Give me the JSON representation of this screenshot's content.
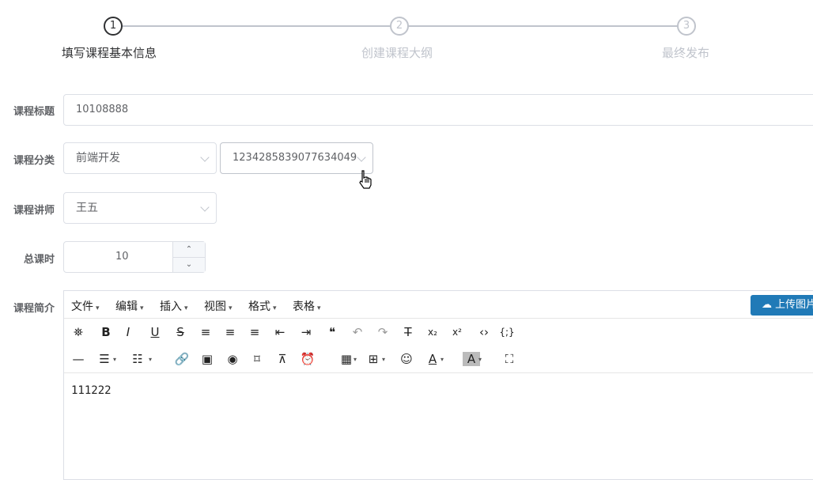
{
  "steps": [
    {
      "number": "1",
      "label": "填写课程基本信息"
    },
    {
      "number": "2",
      "label": "创建课程大纲"
    },
    {
      "number": "3",
      "label": "最终发布"
    }
  ],
  "form": {
    "title": {
      "label": "课程标题",
      "value": "10108888"
    },
    "category": {
      "label": "课程分类",
      "primary": "前端开发",
      "secondary": "1234285839077634049"
    },
    "teacher": {
      "label": "课程讲师",
      "value": "王五"
    },
    "lessons": {
      "label": "总课时",
      "value": "10",
      "up": "⌃",
      "down": "⌄"
    },
    "description": {
      "label": "课程简介"
    }
  },
  "editor": {
    "menus": [
      "文件",
      "编辑",
      "插入",
      "视图",
      "格式",
      "表格"
    ],
    "upload_label": "上传图片",
    "content": "111222",
    "toolbar_row1": [
      {
        "name": "binoculars-icon",
        "glyph": "⛯"
      },
      {
        "name": "bold-icon",
        "glyph": "B"
      },
      {
        "name": "italic-icon",
        "glyph": "I"
      },
      {
        "name": "underline-icon",
        "glyph": "U"
      },
      {
        "name": "strikethrough-icon",
        "glyph": "S"
      },
      {
        "name": "align-left-icon",
        "glyph": "≡"
      },
      {
        "name": "align-center-icon",
        "glyph": "≡"
      },
      {
        "name": "align-right-icon",
        "glyph": "≡"
      },
      {
        "name": "outdent-icon",
        "glyph": "⇤"
      },
      {
        "name": "indent-icon",
        "glyph": "⇥"
      },
      {
        "name": "blockquote-icon",
        "glyph": "❝"
      },
      {
        "name": "undo-icon",
        "glyph": "↶"
      },
      {
        "name": "redo-icon",
        "glyph": "↷"
      },
      {
        "name": "clear-format-icon",
        "glyph": "T̶"
      },
      {
        "name": "subscript-icon",
        "glyph": "x₂"
      },
      {
        "name": "superscript-icon",
        "glyph": "x²"
      },
      {
        "name": "code-icon",
        "glyph": "‹›"
      },
      {
        "name": "code-block-icon",
        "glyph": "{;}"
      }
    ],
    "toolbar_row2": [
      {
        "name": "horizontal-rule-icon",
        "glyph": "—"
      },
      {
        "name": "bullet-list-icon",
        "glyph": "☰"
      },
      {
        "name": "numbered-list-icon",
        "glyph": "☷"
      },
      {
        "name": "link-icon",
        "glyph": "🔗"
      },
      {
        "name": "image-icon",
        "glyph": "▣"
      },
      {
        "name": "preview-icon",
        "glyph": "◉"
      },
      {
        "name": "bookmark-icon",
        "glyph": "⌑"
      },
      {
        "name": "page-break-icon",
        "glyph": "⊼"
      },
      {
        "name": "alarm-icon",
        "glyph": "⏰"
      },
      {
        "name": "media-icon",
        "glyph": "▦"
      },
      {
        "name": "table-icon",
        "glyph": "⊞"
      },
      {
        "name": "emoji-icon",
        "glyph": "☺"
      },
      {
        "name": "text-color-icon",
        "glyph": "A"
      },
      {
        "name": "background-color-icon",
        "glyph": "A"
      },
      {
        "name": "fullscreen-icon",
        "glyph": "⛶"
      }
    ]
  },
  "colors": {
    "accent": "#409eff",
    "upload": "#207ab7"
  }
}
